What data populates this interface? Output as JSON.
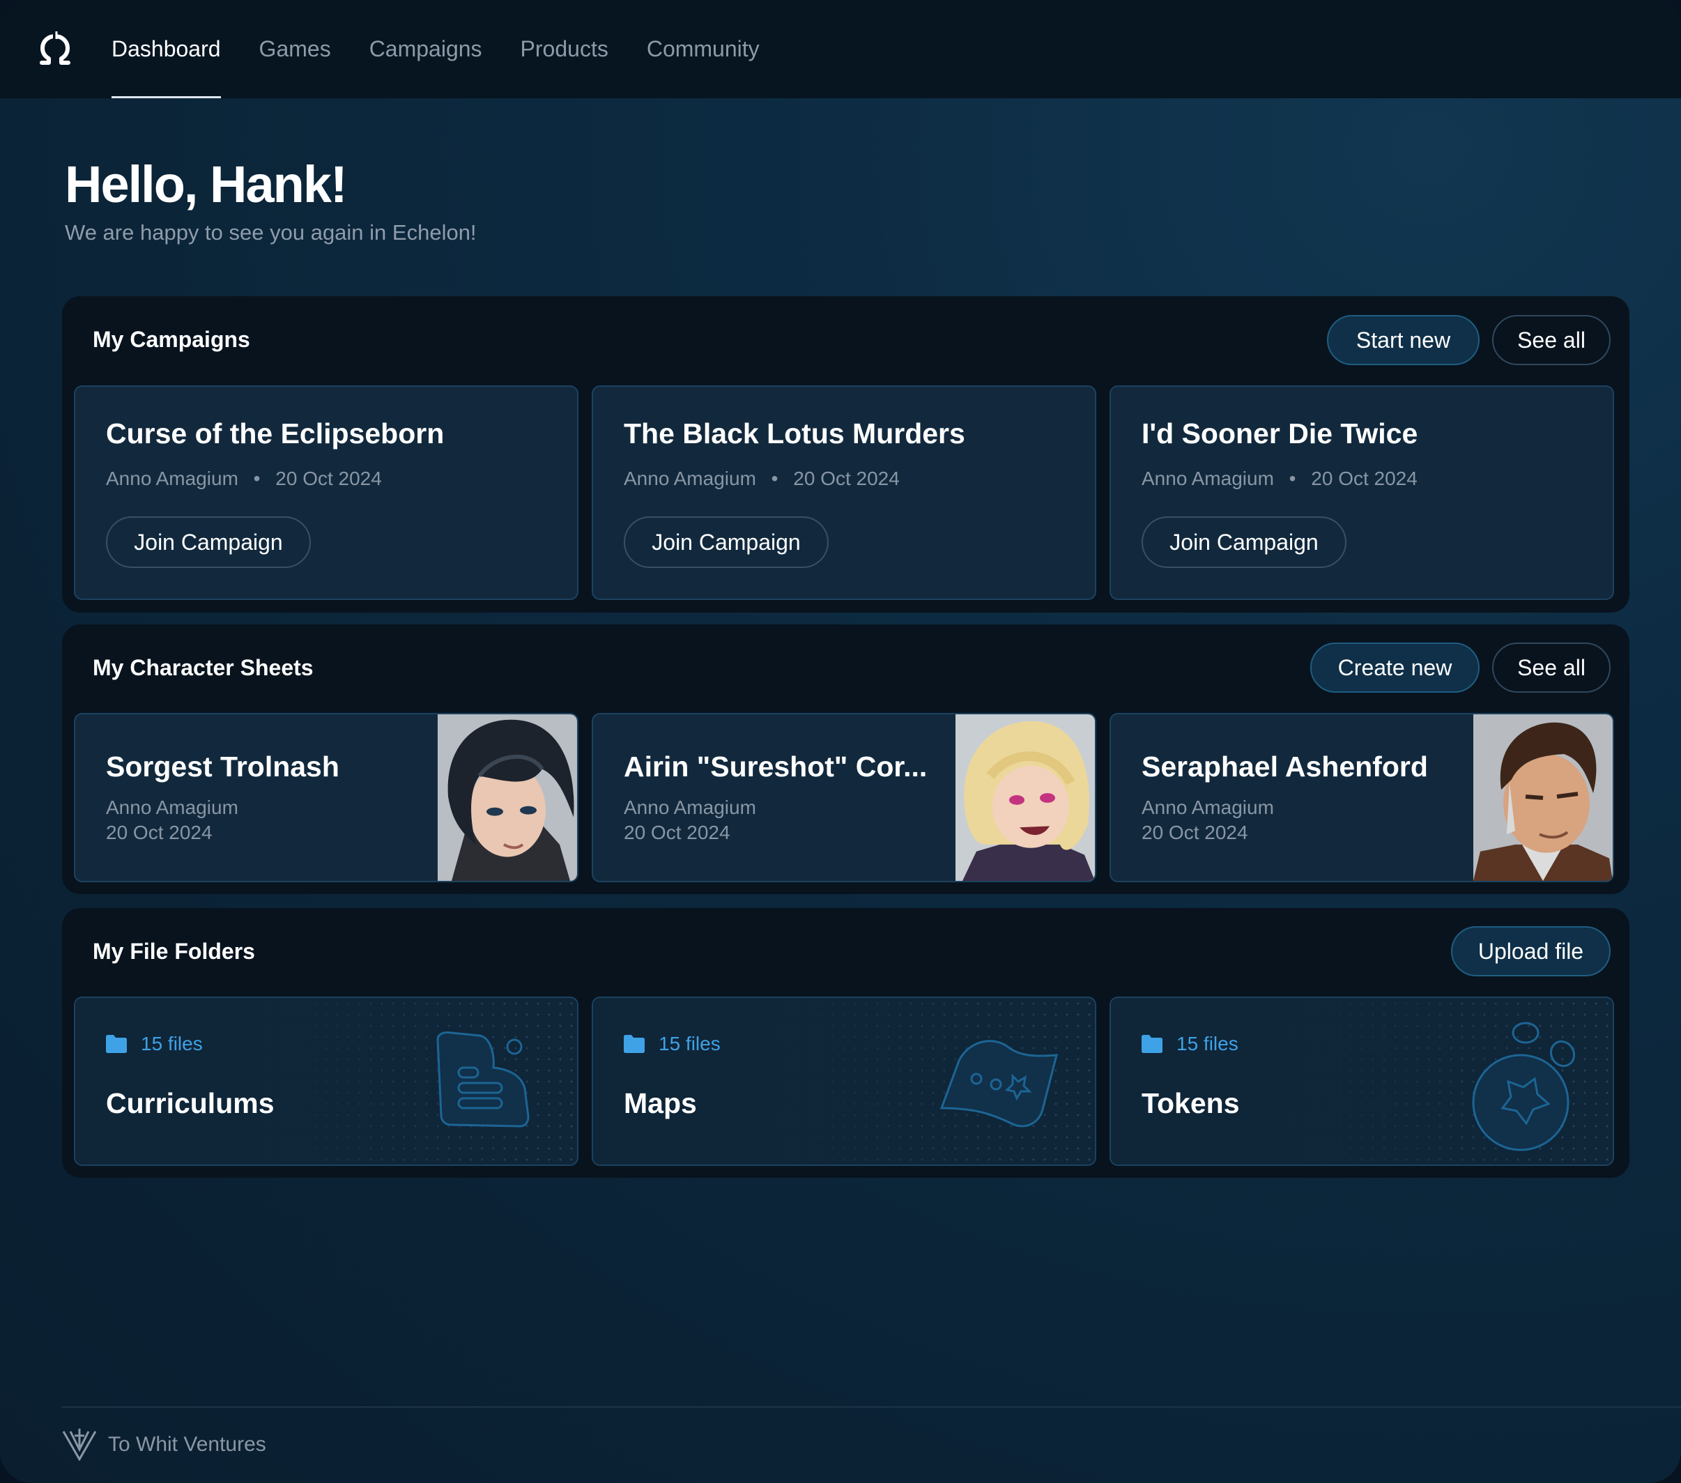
{
  "nav": {
    "items": [
      "Dashboard",
      "Games",
      "Campaigns",
      "Products",
      "Community"
    ],
    "active": "Dashboard"
  },
  "greeting": {
    "title": "Hello, Hank!",
    "subtitle": "We are happy to see you again in Echelon!"
  },
  "campaigns": {
    "title": "My Campaigns",
    "start_new": "Start new",
    "see_all": "See all",
    "items": [
      {
        "title": "Curse of the Eclipseborn",
        "author": "Anno Amagium",
        "date": "20 Oct 2024",
        "action": "Join Campaign"
      },
      {
        "title": "The Black Lotus Murders",
        "author": "Anno Amagium",
        "date": "20 Oct 2024",
        "action": "Join Campaign"
      },
      {
        "title": "I'd Sooner Die Twice",
        "author": "Anno Amagium",
        "date": "20 Oct 2024",
        "action": "Join Campaign"
      }
    ]
  },
  "characters": {
    "title": "My Character Sheets",
    "create_new": "Create new",
    "see_all": "See all",
    "items": [
      {
        "name": "Sorgest Trolnash",
        "author": "Anno Amagium",
        "date": "20 Oct 2024"
      },
      {
        "name": "Airin \"Sureshot\" Cor...",
        "author": "Anno Amagium",
        "date": "20 Oct 2024"
      },
      {
        "name": "Seraphael Ashenford",
        "author": "Anno Amagium",
        "date": "20 Oct 2024"
      }
    ]
  },
  "folders": {
    "title": "My File Folders",
    "upload": "Upload file",
    "items": [
      {
        "count": "15 files",
        "name": "Curriculums",
        "icon": "document-icon"
      },
      {
        "count": "15 files",
        "name": "Maps",
        "icon": "map-icon"
      },
      {
        "count": "15 files",
        "name": "Tokens",
        "icon": "token-icon"
      }
    ]
  },
  "footer": {
    "company": "To Whit Ventures"
  },
  "colors": {
    "accent": "#3fa2e6",
    "panel": "#08131e",
    "card": "#12293d"
  }
}
